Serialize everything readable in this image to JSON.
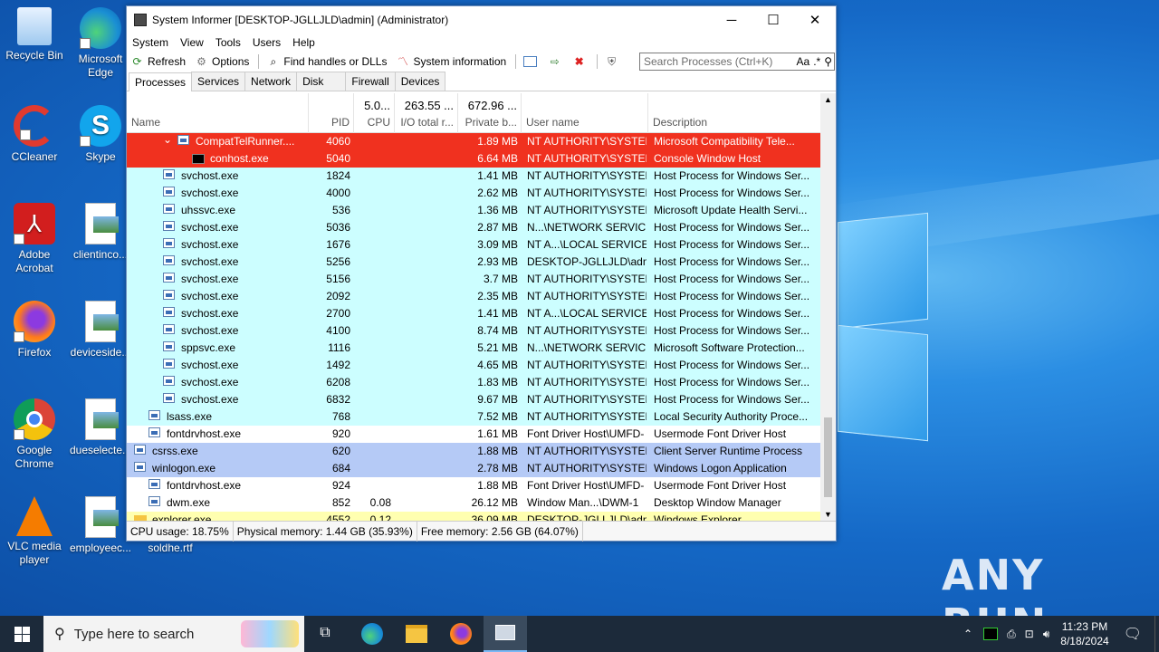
{
  "window": {
    "title": "System Informer [DESKTOP-JGLLJLD\\admin] (Administrator)",
    "minimize": "─",
    "maximize": "☐",
    "close": "✕"
  },
  "menu": [
    "System",
    "View",
    "Tools",
    "Users",
    "Help"
  ],
  "toolbar": {
    "refresh": "Refresh",
    "options": "Options",
    "find": "Find handles or DLLs",
    "sysinfo": "System information"
  },
  "search": {
    "placeholder": "Search Processes (Ctrl+K)",
    "case": "Aa",
    "regex": ".*"
  },
  "tabs": [
    "Processes",
    "Services",
    "Network",
    "Disk",
    "Firewall",
    "Devices"
  ],
  "columns": {
    "name": "Name",
    "pid": "PID",
    "cpu": "CPU",
    "io": "I/O total r...",
    "private": "Private b...",
    "user": "User name",
    "desc": "Description",
    "cpu_total": "5.0...",
    "io_total": "263.55 ...",
    "private_total": "672.96 ..."
  },
  "rows": [
    {
      "name": "CompatTelRunner....",
      "pid": "4060",
      "cpu": "",
      "priv": "1.89 MB",
      "user": "NT AUTHORITY\\SYSTEM",
      "desc": "Microsoft Compatibility Tele...",
      "bg": "#f0311f",
      "indent": 3,
      "expander": "v",
      "icon": "proc"
    },
    {
      "name": "conhost.exe",
      "pid": "5040",
      "cpu": "",
      "priv": "6.64 MB",
      "user": "NT AUTHORITY\\SYSTEM",
      "desc": "Console Window Host",
      "bg": "#f0311f",
      "indent": 4,
      "expander": "",
      "icon": "console"
    },
    {
      "name": "svchost.exe",
      "pid": "1824",
      "cpu": "",
      "priv": "1.41 MB",
      "user": "NT AUTHORITY\\SYSTEM",
      "desc": "Host Process for Windows Ser...",
      "bg": "#ccfeff",
      "indent": 2,
      "expander": "",
      "icon": "proc"
    },
    {
      "name": "svchost.exe",
      "pid": "4000",
      "cpu": "",
      "priv": "2.62 MB",
      "user": "NT AUTHORITY\\SYSTEM",
      "desc": "Host Process for Windows Ser...",
      "bg": "#ccfeff",
      "indent": 2,
      "expander": "",
      "icon": "proc"
    },
    {
      "name": "uhssvc.exe",
      "pid": "536",
      "cpu": "",
      "priv": "1.36 MB",
      "user": "NT AUTHORITY\\SYSTEM",
      "desc": "Microsoft Update Health Servi...",
      "bg": "#ccfeff",
      "indent": 2,
      "expander": "",
      "icon": "proc"
    },
    {
      "name": "svchost.exe",
      "pid": "5036",
      "cpu": "",
      "priv": "2.87 MB",
      "user": "N...\\NETWORK SERVICE",
      "desc": "Host Process for Windows Ser...",
      "bg": "#ccfeff",
      "indent": 2,
      "expander": "",
      "icon": "proc"
    },
    {
      "name": "svchost.exe",
      "pid": "1676",
      "cpu": "",
      "priv": "3.09 MB",
      "user": "NT A...\\LOCAL SERVICE",
      "desc": "Host Process for Windows Ser...",
      "bg": "#ccfeff",
      "indent": 2,
      "expander": "",
      "icon": "proc"
    },
    {
      "name": "svchost.exe",
      "pid": "5256",
      "cpu": "",
      "priv": "2.93 MB",
      "user": "DESKTOP-JGLLJLD\\admi",
      "desc": "Host Process for Windows Ser...",
      "bg": "#ccfeff",
      "indent": 2,
      "expander": "",
      "icon": "proc"
    },
    {
      "name": "svchost.exe",
      "pid": "5156",
      "cpu": "",
      "priv": "3.7 MB",
      "user": "NT AUTHORITY\\SYSTEM",
      "desc": "Host Process for Windows Ser...",
      "bg": "#ccfeff",
      "indent": 2,
      "expander": "",
      "icon": "proc"
    },
    {
      "name": "svchost.exe",
      "pid": "2092",
      "cpu": "",
      "priv": "2.35 MB",
      "user": "NT AUTHORITY\\SYSTEM",
      "desc": "Host Process for Windows Ser...",
      "bg": "#ccfeff",
      "indent": 2,
      "expander": "",
      "icon": "proc"
    },
    {
      "name": "svchost.exe",
      "pid": "2700",
      "cpu": "",
      "priv": "1.41 MB",
      "user": "NT A...\\LOCAL SERVICE",
      "desc": "Host Process for Windows Ser...",
      "bg": "#ccfeff",
      "indent": 2,
      "expander": "",
      "icon": "proc"
    },
    {
      "name": "svchost.exe",
      "pid": "4100",
      "cpu": "",
      "priv": "8.74 MB",
      "user": "NT AUTHORITY\\SYSTEM",
      "desc": "Host Process for Windows Ser...",
      "bg": "#ccfeff",
      "indent": 2,
      "expander": "",
      "icon": "proc"
    },
    {
      "name": "sppsvc.exe",
      "pid": "1116",
      "cpu": "",
      "priv": "5.21 MB",
      "user": "N...\\NETWORK SERVICE",
      "desc": "Microsoft Software Protection...",
      "bg": "#ccfeff",
      "indent": 2,
      "expander": "",
      "icon": "proc"
    },
    {
      "name": "svchost.exe",
      "pid": "1492",
      "cpu": "",
      "priv": "4.65 MB",
      "user": "NT AUTHORITY\\SYSTEM",
      "desc": "Host Process for Windows Ser...",
      "bg": "#ccfeff",
      "indent": 2,
      "expander": "",
      "icon": "proc"
    },
    {
      "name": "svchost.exe",
      "pid": "6208",
      "cpu": "",
      "priv": "1.83 MB",
      "user": "NT AUTHORITY\\SYSTEM",
      "desc": "Host Process for Windows Ser...",
      "bg": "#ccfeff",
      "indent": 2,
      "expander": "",
      "icon": "proc"
    },
    {
      "name": "svchost.exe",
      "pid": "6832",
      "cpu": "",
      "priv": "9.67 MB",
      "user": "NT AUTHORITY\\SYSTEM",
      "desc": "Host Process for Windows Ser...",
      "bg": "#ccfeff",
      "indent": 2,
      "expander": "",
      "icon": "proc"
    },
    {
      "name": "lsass.exe",
      "pid": "768",
      "cpu": "",
      "priv": "7.52 MB",
      "user": "NT AUTHORITY\\SYSTEM",
      "desc": "Local Security Authority Proce...",
      "bg": "#ccfeff",
      "indent": 1,
      "expander": "",
      "icon": "proc"
    },
    {
      "name": "fontdrvhost.exe",
      "pid": "920",
      "cpu": "",
      "priv": "1.61 MB",
      "user": "Font Driver Host\\UMFD-",
      "desc": "Usermode Font Driver Host",
      "bg": "#ffffff",
      "indent": 1,
      "expander": "",
      "icon": "proc"
    },
    {
      "name": "csrss.exe",
      "pid": "620",
      "cpu": "",
      "priv": "1.88 MB",
      "user": "NT AUTHORITY\\SYSTEM",
      "desc": "Client Server Runtime Process",
      "bg": "#b5caf6",
      "indent": 0,
      "expander": "",
      "icon": "proc"
    },
    {
      "name": "winlogon.exe",
      "pid": "684",
      "cpu": "",
      "priv": "2.78 MB",
      "user": "NT AUTHORITY\\SYSTEM",
      "desc": "Windows Logon Application",
      "bg": "#b5caf6",
      "indent": 0,
      "expander": "v",
      "icon": "proc"
    },
    {
      "name": "fontdrvhost.exe",
      "pid": "924",
      "cpu": "",
      "priv": "1.88 MB",
      "user": "Font Driver Host\\UMFD-",
      "desc": "Usermode Font Driver Host",
      "bg": "#ffffff",
      "indent": 1,
      "expander": "",
      "icon": "proc"
    },
    {
      "name": "dwm.exe",
      "pid": "852",
      "cpu": "0.08",
      "priv": "26.12 MB",
      "user": "Window Man...\\DWM-1",
      "desc": "Desktop Window Manager",
      "bg": "#ffffff",
      "indent": 1,
      "expander": "",
      "icon": "proc"
    },
    {
      "name": "explorer.exe",
      "pid": "4552",
      "cpu": "0.12",
      "priv": "36.09 MB",
      "user": "DESKTOP-JGLLJLD\\admi",
      "desc": "Windows Explorer",
      "bg": "#ffffb0",
      "indent": 0,
      "expander": "",
      "icon": "folder"
    }
  ],
  "status": {
    "cpu": "CPU usage: 18.75%",
    "physical": "Physical memory: 1.44 GB (35.93%)",
    "free": "Free memory: 2.56 GB (64.07%)"
  },
  "desktop_icons": [
    {
      "label": "Recycle Bin",
      "icon": "recycle-bin-icon"
    },
    {
      "label": "Microsoft Edge",
      "icon": "edge-icon"
    },
    {
      "label": "CCleaner",
      "icon": "ccleaner-icon"
    },
    {
      "label": "Skype",
      "icon": "skype-icon"
    },
    {
      "label": "Adobe Acrobat",
      "icon": "acrobat-icon"
    },
    {
      "label": "clientinco...",
      "icon": "document-icon"
    },
    {
      "label": "Firefox",
      "icon": "firefox-icon"
    },
    {
      "label": "deviceside...",
      "icon": "document-icon"
    },
    {
      "label": "Google Chrome",
      "icon": "chrome-icon"
    },
    {
      "label": "dueselecte...",
      "icon": "document-icon"
    },
    {
      "label": "VLC media player",
      "icon": "vlc-icon"
    },
    {
      "label": "employeec...",
      "icon": "document-icon"
    }
  ],
  "partial_label": "soldhe.rtf",
  "watermark": "ANY RUN",
  "taskbar": {
    "search_placeholder": "Type here to search",
    "time": "11:23 PM",
    "date": "8/18/2024"
  }
}
